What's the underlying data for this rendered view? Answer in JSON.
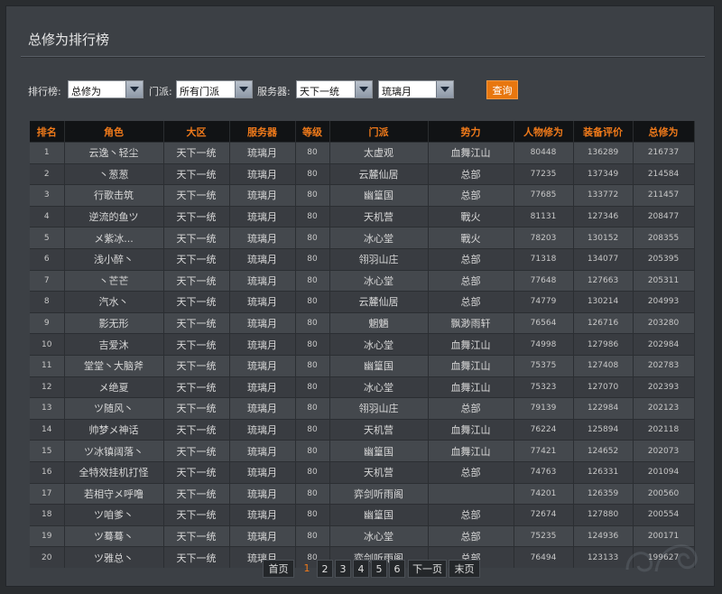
{
  "page_title": "总修为排行榜",
  "filters": {
    "ranking_label": "排行榜:",
    "ranking_value": "总修为",
    "sect_label": "门派:",
    "sect_value": "所有门派",
    "server_label": "服务器:",
    "server_group_value": "天下一统",
    "server_value": "琉璃月",
    "query_label": "查询"
  },
  "table": {
    "headers": [
      "排名",
      "角色",
      "大区",
      "服务器",
      "等级",
      "门派",
      "势力",
      "人物修为",
      "装备评价",
      "总修为"
    ],
    "rows": [
      [
        "1",
        "云逸丶轻尘",
        "天下一统",
        "琉璃月",
        "80",
        "太虚观",
        "血舞江山",
        "80448",
        "136289",
        "216737"
      ],
      [
        "2",
        "丶葱葱",
        "天下一统",
        "琉璃月",
        "80",
        "云麓仙居",
        "总部",
        "77235",
        "137349",
        "214584"
      ],
      [
        "3",
        "行歌击筑",
        "天下一统",
        "琉璃月",
        "80",
        "幽篁国",
        "总部",
        "77685",
        "133772",
        "211457"
      ],
      [
        "4",
        "逆流的鱼ツ",
        "天下一统",
        "琉璃月",
        "80",
        "天机营",
        "戰火",
        "81131",
        "127346",
        "208477"
      ],
      [
        "5",
        "メ紫冰...",
        "天下一统",
        "琉璃月",
        "80",
        "冰心堂",
        "戰火",
        "78203",
        "130152",
        "208355"
      ],
      [
        "6",
        "浅小醉丶",
        "天下一统",
        "琉璃月",
        "80",
        "翎羽山庄",
        "总部",
        "71318",
        "134077",
        "205395"
      ],
      [
        "7",
        "丶芒芒",
        "天下一统",
        "琉璃月",
        "80",
        "冰心堂",
        "总部",
        "77648",
        "127663",
        "205311"
      ],
      [
        "8",
        "汽水丶",
        "天下一统",
        "琉璃月",
        "80",
        "云麓仙居",
        "总部",
        "74779",
        "130214",
        "204993"
      ],
      [
        "9",
        "影无形",
        "天下一统",
        "琉璃月",
        "80",
        "魍魉",
        "飘渺雨轩",
        "76564",
        "126716",
        "203280"
      ],
      [
        "10",
        "吉爱沐",
        "天下一统",
        "琉璃月",
        "80",
        "冰心堂",
        "血舞江山",
        "74998",
        "127986",
        "202984"
      ],
      [
        "11",
        "堂堂丶大脑斧",
        "天下一统",
        "琉璃月",
        "80",
        "幽篁国",
        "血舞江山",
        "75375",
        "127408",
        "202783"
      ],
      [
        "12",
        "メ绝夏",
        "天下一统",
        "琉璃月",
        "80",
        "冰心堂",
        "血舞江山",
        "75323",
        "127070",
        "202393"
      ],
      [
        "13",
        "ツ随风丶",
        "天下一统",
        "琉璃月",
        "80",
        "翎羽山庄",
        "总部",
        "79139",
        "122984",
        "202123"
      ],
      [
        "14",
        "帅梦メ神话",
        "天下一统",
        "琉璃月",
        "80",
        "天机营",
        "血舞江山",
        "76224",
        "125894",
        "202118"
      ],
      [
        "15",
        "ツ冰镇阔落丶",
        "天下一统",
        "琉璃月",
        "80",
        "幽篁国",
        "血舞江山",
        "77421",
        "124652",
        "202073"
      ],
      [
        "16",
        "全特效挂机打怪",
        "天下一统",
        "琉璃月",
        "80",
        "天机营",
        "总部",
        "74763",
        "126331",
        "201094"
      ],
      [
        "17",
        "若相守メ呼噜",
        "天下一统",
        "琉璃月",
        "80",
        "弈剑听雨阁",
        "",
        "74201",
        "126359",
        "200560"
      ],
      [
        "18",
        "ツ咱爹丶",
        "天下一统",
        "琉璃月",
        "80",
        "幽篁国",
        "总部",
        "72674",
        "127880",
        "200554"
      ],
      [
        "19",
        "ツ蓦蓦丶",
        "天下一统",
        "琉璃月",
        "80",
        "冰心堂",
        "总部",
        "75235",
        "124936",
        "200171"
      ],
      [
        "20",
        "ツ雅总丶",
        "天下一统",
        "琉璃月",
        "80",
        "弈剑听雨阁",
        "总部",
        "76494",
        "123133",
        "199627"
      ]
    ]
  },
  "pager": {
    "first": "首页",
    "pages": [
      "1",
      "2",
      "3",
      "4",
      "5",
      "6"
    ],
    "current": "1",
    "next": "下一页",
    "last": "末页"
  }
}
